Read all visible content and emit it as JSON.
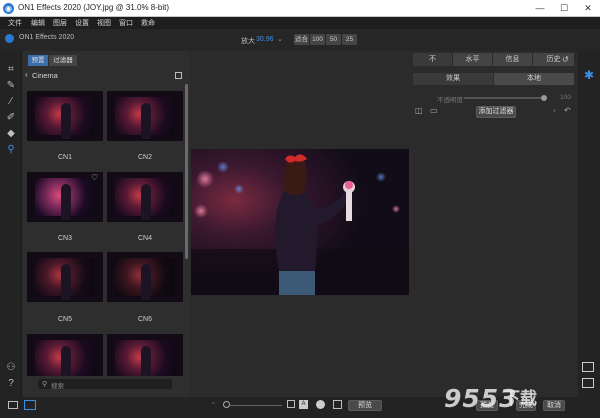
{
  "window": {
    "title": "ON1 Effects 2020 (JOY.jpg @ 31.0% 8-bit)",
    "controls": {
      "minimize": "—",
      "maximize": "☐",
      "close": "✕"
    }
  },
  "menubar": {
    "items": [
      "文件",
      "编辑",
      "图层",
      "设置",
      "视图",
      "窗口",
      "救命"
    ]
  },
  "toolbar": {
    "app_name": "ON1 Effects 2020",
    "zoom_label": "放大",
    "zoom_value": "30.96",
    "zoom_buttons": [
      "适合",
      "100",
      "50",
      "25"
    ]
  },
  "left_tools": {
    "icons": [
      "crop-icon",
      "brush-icon",
      "retouch-icon",
      "masking-brush-icon",
      "eraser-icon",
      "search-adjust-icon"
    ],
    "bottom_icons": [
      "person-icon",
      "help-icon"
    ]
  },
  "browser": {
    "tabs": [
      "预置",
      "过滤器"
    ],
    "breadcrumb": "Cinema",
    "presets": [
      {
        "label": "CN1"
      },
      {
        "label": "CN2"
      },
      {
        "label": "CN3"
      },
      {
        "label": "CN4"
      },
      {
        "label": "CN5"
      },
      {
        "label": "CN6"
      },
      {
        "label": ""
      },
      {
        "label": ""
      }
    ],
    "search_placeholder": "搜索"
  },
  "right_panel": {
    "tabs": [
      "不",
      "水平",
      "信息",
      "历史"
    ],
    "subtabs": [
      "效果",
      "本地"
    ],
    "opacity_label": "不透明度",
    "opacity_value": "100",
    "opacity_level_percent": 100,
    "add_filter_label": "添加过滤器"
  },
  "bottom_bar": {
    "buttons": [
      "预览",
      "取消",
      "完成",
      "取消"
    ],
    "compare_label": "预览"
  },
  "watermark": {
    "brand": "9553",
    "sub": "下载"
  },
  "colors": {
    "accent": "#3f8fe6",
    "tab_active": "#3b6ea8",
    "background": "#2b2b2b",
    "panel": "#2e2e2e"
  }
}
